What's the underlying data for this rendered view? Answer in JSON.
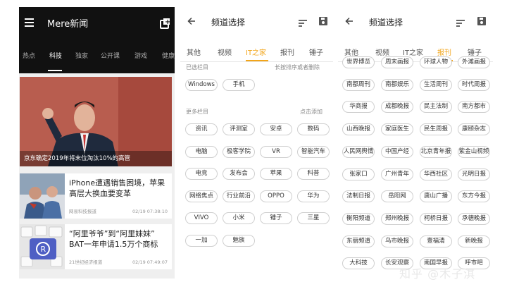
{
  "app": {
    "title": "Mere新闻"
  },
  "home_tabs": [
    "热点",
    "科技",
    "独家",
    "公开课",
    "游戏",
    "健康"
  ],
  "hero": {
    "caption": "京东确定2019年将末位淘汰10%的高管"
  },
  "news": [
    {
      "title": "iPhone遭遇销售困境，苹果高层大换血要变革",
      "source": "网易科技报道",
      "time": "02/19 07:38:10"
    },
    {
      "title": "“阿里爷爷”到“阿里妹妹” BAT一年申请1.5万个商标",
      "source": "21世纪经济报道",
      "time": "02/19 07:49:07"
    }
  ],
  "channel": {
    "title": "频道选择",
    "tabs": [
      "其他",
      "视频",
      "IT之家",
      "报刊",
      "锤子"
    ],
    "selected_label": "已选栏目",
    "selected_hint": "长按排序或者删除",
    "selected": [
      "Windows",
      "手机"
    ],
    "more_label": "更多栏目",
    "more_hint": "点击添加",
    "more": [
      "资讯",
      "评测室",
      "安卓",
      "数码",
      "电脑",
      "极客学院",
      "VR",
      "智能汽车",
      "电竞",
      "发布会",
      "苹果",
      "科普",
      "网络焦点",
      "行业前沿",
      "OPPO",
      "华为",
      "VIVO",
      "小米",
      "锤子",
      "三星",
      "一加",
      "魅族"
    ]
  },
  "paper": {
    "title": "频道选择",
    "tabs": [
      "其他",
      "视频",
      "IT之家",
      "报刊",
      "锤子"
    ],
    "items": [
      "世界博览",
      "周末画报",
      "环球人物",
      "外滩画报",
      "南都周刊",
      "南都娱乐",
      "生活周刊",
      "时代周报",
      "华商报",
      "成都晚报",
      "民主法制",
      "南方都市",
      "山西晚报",
      "家庭医生",
      "民生周报",
      "康颐杂志",
      "人民网舆情",
      "中国产经",
      "北京青年报",
      "紫金山视频",
      "张家口",
      "广州青年",
      "华西社区",
      "光明日报",
      "法制日报",
      "岳阳网",
      "唐山广播",
      "东方今报",
      "衡阳频道",
      "郑州晚报",
      "柯桥日报",
      "承德晚报",
      "东丽频道",
      "乌市晚报",
      "壹福清",
      "新晚报",
      "大科技",
      "长安观察",
      "南国早报",
      "呼市吧"
    ]
  },
  "watermark": "知乎 @木子淇",
  "colors": {
    "accent": "#f2a51a",
    "dark_bar": "#111111"
  }
}
